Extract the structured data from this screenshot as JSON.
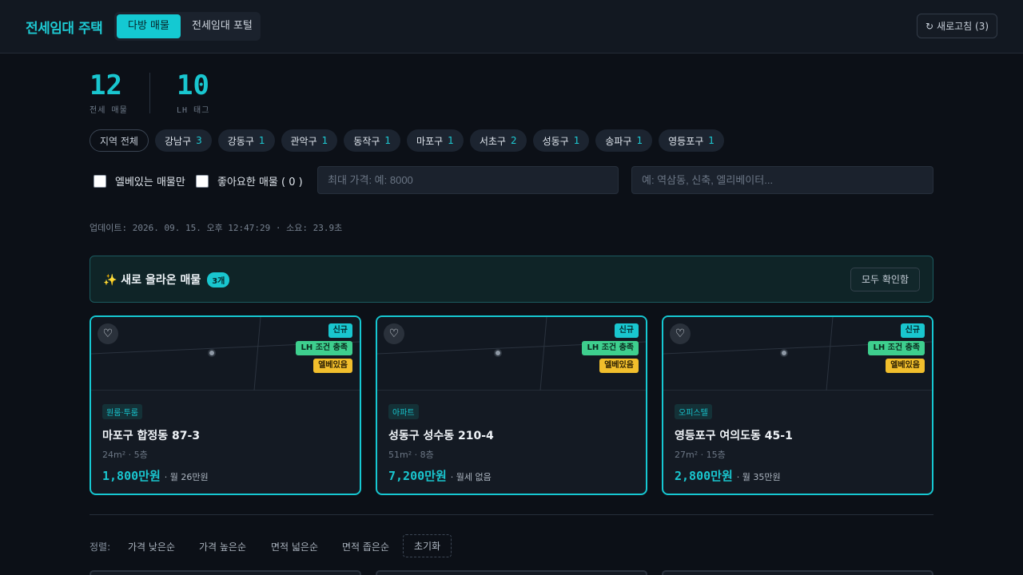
{
  "header": {
    "brand": "전세임대 주택",
    "tabs": [
      {
        "label": "다방 매물",
        "active": true
      },
      {
        "label": "전세임대 포털",
        "active": false
      }
    ],
    "refresh_label": "새로고침 (3)",
    "refresh_icon": "refresh-icon"
  },
  "stats": [
    {
      "value": "12",
      "label": "전세 매물"
    },
    {
      "value": "10",
      "label": "LH 태그"
    }
  ],
  "regions": {
    "all_label": "지역 전체",
    "items": [
      {
        "name": "강남구",
        "count": "3"
      },
      {
        "name": "강동구",
        "count": "1"
      },
      {
        "name": "관악구",
        "count": "1"
      },
      {
        "name": "동작구",
        "count": "1"
      },
      {
        "name": "마포구",
        "count": "1"
      },
      {
        "name": "서초구",
        "count": "2"
      },
      {
        "name": "성동구",
        "count": "1"
      },
      {
        "name": "송파구",
        "count": "1"
      },
      {
        "name": "영등포구",
        "count": "1"
      }
    ]
  },
  "filters": {
    "elevator_only_label": "엘베있는 매물만",
    "liked_label": "좋아요한 매물 ( 0 )",
    "max_price_placeholder": "최대 가격: 예: 8000",
    "keyword_placeholder": "예: 역삼동, 신축, 엘리베이터..."
  },
  "updated_text": "업데이트: 2026. 09. 15. 오후 12:47:29 · 소요: 23.9초",
  "new_banner": {
    "title": "✨ 새로 올라온 매물",
    "badge": "3개",
    "confirm_all_label": "모두 확인함"
  },
  "cards": [
    {
      "tags": [
        "신규",
        "LH 조건 충족",
        "엘베있음"
      ],
      "type": "원룸·투룸",
      "title": "마포구 합정동 87-3",
      "meta": "24m² · 5층",
      "price": "1,800만원",
      "rent": "· 월 26만원"
    },
    {
      "tags": [
        "신규",
        "LH 조건 충족",
        "엘베있음"
      ],
      "type": "아파트",
      "title": "성동구 성수동 210-4",
      "meta": "51m² · 8층",
      "price": "7,200만원",
      "rent": "· 월세 없음"
    },
    {
      "tags": [
        "신규",
        "LH 조건 충족",
        "엘베있음"
      ],
      "type": "오피스텔",
      "title": "영등포구 여의도동 45-1",
      "meta": "27m² · 15층",
      "price": "2,800만원",
      "rent": "· 월 35만원"
    }
  ],
  "sort": {
    "label": "정렬:",
    "options": [
      "가격 낮은순",
      "가격 높은순",
      "면적 넓은순",
      "면적 좁은순"
    ],
    "reset_label": "초기화"
  },
  "colors": {
    "accent": "#19c6cf",
    "lh_tag": "#3ecf8e",
    "elevator_tag": "#f1be2c",
    "background": "#0c1017"
  }
}
